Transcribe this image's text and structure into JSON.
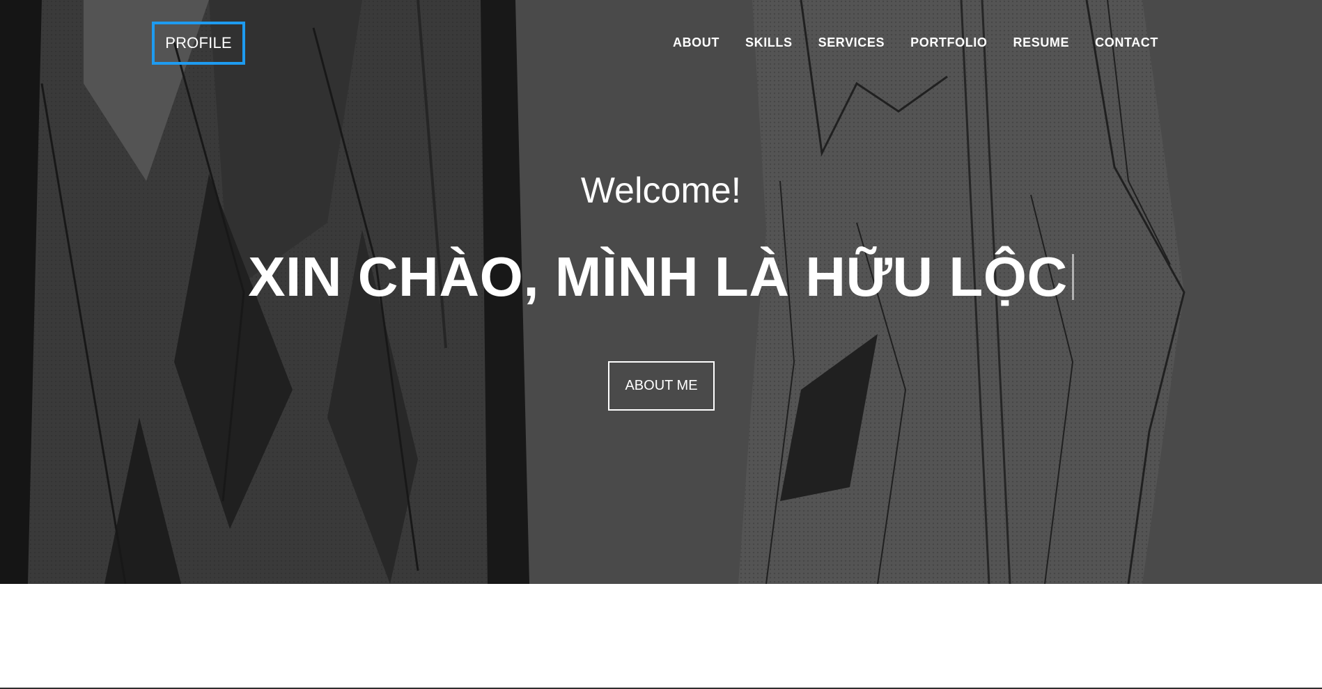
{
  "colors": {
    "hero_background": "#4a4a4a",
    "accent_border": "#1e9bf0",
    "text": "#ffffff"
  },
  "header": {
    "logo": "PROFILE",
    "nav": [
      "ABOUT",
      "SKILLS",
      "SERVICES",
      "PORTFOLIO",
      "RESUME",
      "CONTACT"
    ]
  },
  "hero": {
    "welcome": "Welcome!",
    "headline": "XIN CHÀO, MÌNH LÀ HỮU LỘC",
    "button_label": "ABOUT ME",
    "background_art": "manga-illustration-background"
  }
}
